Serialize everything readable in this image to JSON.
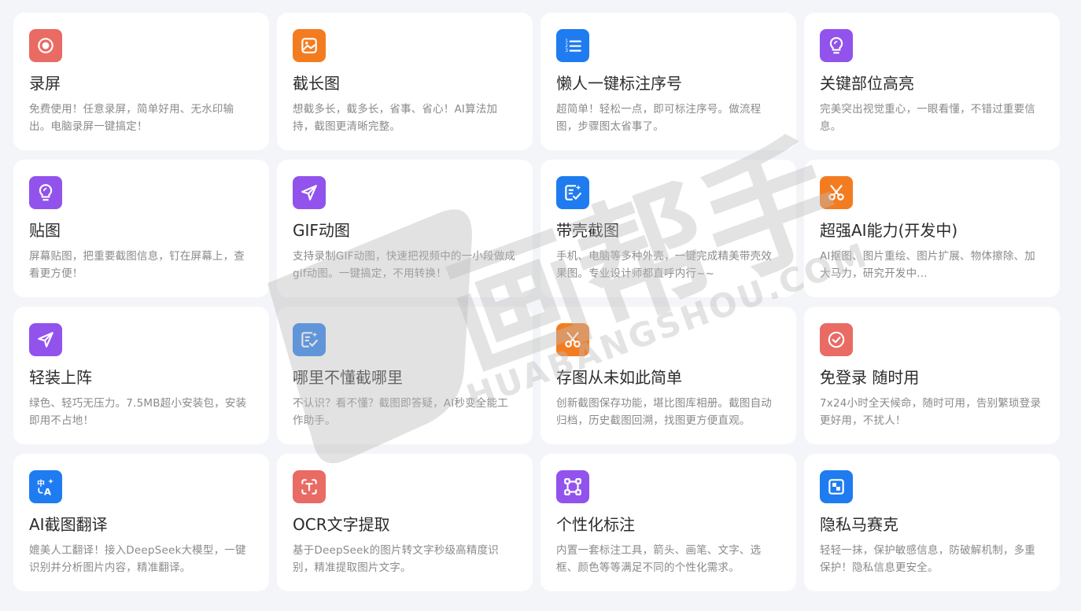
{
  "colors": {
    "red": "#e96b64",
    "orange": "#f47c20",
    "blue": "#1f7cf0",
    "purple": "#9153ec",
    "page_bg": "#f4f5f8",
    "card_bg": "#ffffff",
    "title": "#2b2b2b",
    "desc": "#8a8a8a"
  },
  "cards": [
    {
      "title": "录屏",
      "desc": "免费使用！任意录屏，简单好用、无水印输出。电脑录屏一键搞定！",
      "icon": "record-icon",
      "color": "#e96b64"
    },
    {
      "title": "截长图",
      "desc": "想截多长，截多长，省事、省心！AI算法加持，截图更清晰完整。",
      "icon": "image-icon",
      "color": "#f47c20"
    },
    {
      "title": "懒人一键标注序号",
      "desc": "超简单！轻松一点，即可标注序号。做流程图，步骤图太省事了。",
      "icon": "numbered-list-icon",
      "color": "#1f7cf0"
    },
    {
      "title": "关键部位高亮",
      "desc": "完美突出视觉重心，一眼看懂，不错过重要信息。",
      "icon": "bulb-icon",
      "color": "#9153ec"
    },
    {
      "title": "贴图",
      "desc": "屏幕贴图，把重要截图信息，钉在屏幕上，查看更方便！",
      "icon": "bulb-icon",
      "color": "#9153ec"
    },
    {
      "title": "GIF动图",
      "desc": "支持录制GIF动图，快速把视频中的一小段做成gif动图。一键搞定，不用转换！",
      "icon": "send-icon",
      "color": "#9153ec"
    },
    {
      "title": "带壳截图",
      "desc": "手机、电脑等多种外壳，一键完成精美带壳效果图。专业设计师都直呼内行~~",
      "icon": "magic-edit-icon",
      "color": "#1f7cf0"
    },
    {
      "title": "超强AI能力(开发中)",
      "desc": "AI抠图、图片重绘、图片扩展、物体擦除、加大马力，研究开发中...",
      "icon": "scissors-icon",
      "color": "#f47c20"
    },
    {
      "title": "轻装上阵",
      "desc": "绿色、轻巧无压力。7.5MB超小安装包，安装即用不占地！",
      "icon": "send-icon",
      "color": "#9153ec"
    },
    {
      "title": "哪里不懂截哪里",
      "desc": "不认识？看不懂？截图即答疑，AI秒变全能工作助手。",
      "icon": "magic-edit-icon",
      "color": "#1f7cf0"
    },
    {
      "title": "存图从未如此简单",
      "desc": "创新截图保存功能，堪比图库相册。截图自动归档，历史截图回溯，找图更方便直观。",
      "icon": "scissors-icon",
      "color": "#f47c20"
    },
    {
      "title": "免登录 随时用",
      "desc": "7x24小时全天候命，随时可用，告别繁琐登录更好用，不扰人！",
      "icon": "check-circle-icon",
      "color": "#e96b64"
    },
    {
      "title": "AI截图翻译",
      "desc": "媲美人工翻译！接入DeepSeek大模型，一键识别并分析图片内容，精准翻译。",
      "icon": "translate-icon",
      "color": "#1f7cf0"
    },
    {
      "title": "OCR文字提取",
      "desc": "基于DeepSeek的图片转文字秒级高精度识别，精准提取图片文字。",
      "icon": "text-scan-icon",
      "color": "#e96b64"
    },
    {
      "title": "个性化标注",
      "desc": "内置一套标注工具，箭头、画笔、文字、选框、颜色等等满足不同的个性化需求。",
      "icon": "vector-square-icon",
      "color": "#9153ec"
    },
    {
      "title": "隐私马赛克",
      "desc": "轻轻一抹，保护敏感信息，防破解机制，多重保护！隐私信息更安全。",
      "icon": "mosaic-icon",
      "color": "#1f7cf0"
    }
  ],
  "watermark": {
    "brand": "画帮手",
    "domain": "HUABANGSHOU.COM"
  }
}
